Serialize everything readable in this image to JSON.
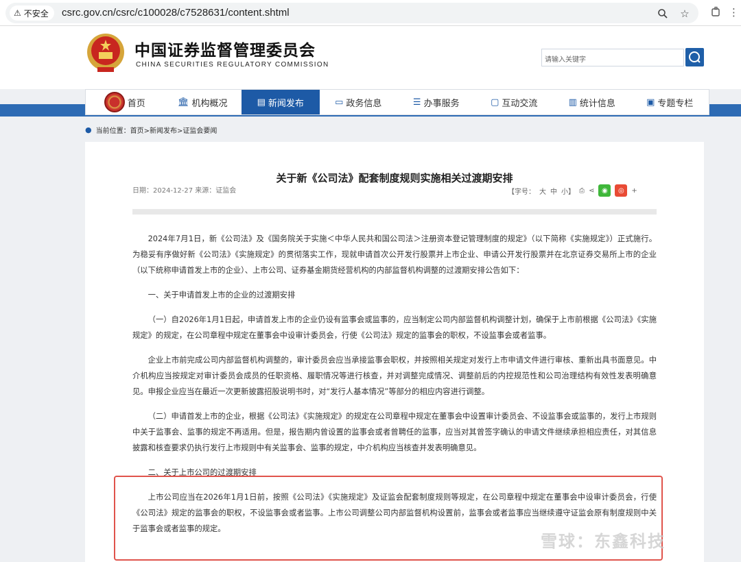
{
  "browser": {
    "security_label": "不安全",
    "url": "csrc.gov.cn/csrc/c100028/c7528631/content.shtml"
  },
  "header": {
    "title": "中国证券监督管理委员会",
    "subtitle": "CHINA SECURITIES REGULATORY COMMISSION",
    "search_placeholder": "请输入关键字"
  },
  "nav": {
    "items": [
      {
        "label": "首页",
        "icon": "home-emblem-icon"
      },
      {
        "label": "机构概况",
        "icon": "building-icon"
      },
      {
        "label": "新闻发布",
        "icon": "news-icon"
      },
      {
        "label": "政务信息",
        "icon": "monitor-icon"
      },
      {
        "label": "办事服务",
        "icon": "list-icon"
      },
      {
        "label": "互动交流",
        "icon": "chat-icon"
      },
      {
        "label": "统计信息",
        "icon": "bar-chart-icon"
      },
      {
        "label": "专题专栏",
        "icon": "document-icon"
      }
    ],
    "active": "新闻发布"
  },
  "breadcrumb": {
    "label": "当前位置：",
    "path": "首页>新闻发布>证监会要闻"
  },
  "article": {
    "title": "关于新《公司法》配套制度规则实施相关过渡期安排",
    "meta": "日期：2024-12-27 来源：证监会",
    "font_size_label": "【字号：",
    "size_large": "大",
    "size_medium": "中",
    "size_small": "小】",
    "more": "+",
    "paragraphs": [
      "2024年7月1日，新《公司法》及《国务院关于实施＜中华人民共和国公司法＞注册资本登记管理制度的规定》（以下简称《实施规定》）正式施行。为稳妥有序做好新《公司法》《实施规定》的贯彻落实工作，现就申请首次公开发行股票并上市企业、申请公开发行股票并在北京证券交易所上市的企业（以下统称申请首发上市的企业）、上市公司、证券基金期货经营机构的内部监督机构调整的过渡期安排公告如下：",
      "一、关于申请首发上市的企业的过渡期安排",
      "（一）自2026年1月1日起，申请首发上市的企业仍设有监事会或监事的，应当制定公司内部监督机构调整计划，确保于上市前根据《公司法》《实施规定》的规定，在公司章程中规定在董事会中设审计委员会，行使《公司法》规定的监事会的职权，不设监事会或者监事。",
      "企业上市前完成公司内部监督机构调整的，审计委员会应当承接监事会职权，并按照相关规定对发行上市申请文件进行审核、重新出具书面意见。中介机构应当按规定对审计委员会成员的任职资格、履职情况等进行核查，并对调整完成情况、调整前后的内控规范性和公司治理结构有效性发表明确意见。申报企业应当在最近一次更新披露招股说明书时，对“发行人基本情况”等部分的相应内容进行调整。",
      "（二）申请首发上市的企业，根据《公司法》《实施规定》的规定在公司章程中规定在董事会中设置审计委员会、不设监事会或监事的，发行上市规则中关于监事会、监事的规定不再适用。但是，报告期内曾设置的监事会或者曾聘任的监事，应当对其曾签字确认的申请文件继续承担相应责任，对其信息披露和核查要求仍执行发行上市规则中有关监事会、监事的规定，中介机构应当核查并发表明确意见。",
      "二、关于上市公司的过渡期安排",
      "上市公司应当在2026年1月1日前，按照《公司法》《实施规定》及证监会配套制度规则等规定，在公司章程中规定在董事会中设审计委员会，行使《公司法》规定的监事会的职权，不设监事会或者监事。上市公司调整公司内部监督机构设置前，监事会或者监事应当继续遵守证监会原有制度规则中关于监事会或者监事的规定。"
    ]
  },
  "watermark": "雪球：东鑫科技"
}
